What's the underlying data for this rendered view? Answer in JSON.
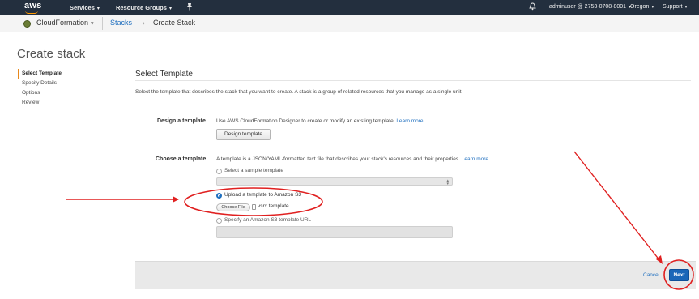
{
  "topnav": {
    "logo": "aws",
    "services": "Services",
    "resource_groups": "Resource Groups",
    "account": "adminuser @ 2753-0708-8001",
    "region": "Oregon",
    "support": "Support",
    "caret": "▾",
    "pin_icon": "pin-icon",
    "bell_icon": "bell-icon"
  },
  "servicebar": {
    "service_name": "CloudFormation",
    "caret": "▾",
    "crumbs": [
      "Stacks",
      "Create Stack"
    ],
    "separator": "›"
  },
  "page": {
    "title": "Create stack",
    "steps": [
      {
        "label": "Select Template",
        "active": true
      },
      {
        "label": "Specify Details",
        "active": false
      },
      {
        "label": "Options",
        "active": false
      },
      {
        "label": "Review",
        "active": false
      }
    ]
  },
  "content": {
    "section_title": "Select Template",
    "intro": "Select the template that describes the stack that you want to create. A stack is a group of related resources that you manage as a single unit.",
    "design": {
      "label": "Design a template",
      "description": "Use AWS CloudFormation Designer to create or modify an existing template.",
      "learn_more": "Learn more.",
      "button": "Design template"
    },
    "choose": {
      "label": "Choose a template",
      "description": "A template is a JSON/YAML-formatted text file that describes your stack's resources and their properties.",
      "learn_more": "Learn more.",
      "options": [
        {
          "label": "Select a sample template",
          "checked": false
        },
        {
          "label": "Upload a template to Amazon S3",
          "checked": true
        },
        {
          "label": "Specify an Amazon S3 template URL",
          "checked": false
        }
      ],
      "choose_file_button": "Choose File",
      "file_name": "vsrx.template"
    }
  },
  "footer": {
    "cancel": "Cancel",
    "next": "Next"
  },
  "colors": {
    "nav_bg": "#232f3e",
    "accent_orange": "#ff9900",
    "link_blue": "#1f6fbf",
    "next_button": "#1a66b8",
    "annotation_red": "#e02020"
  }
}
